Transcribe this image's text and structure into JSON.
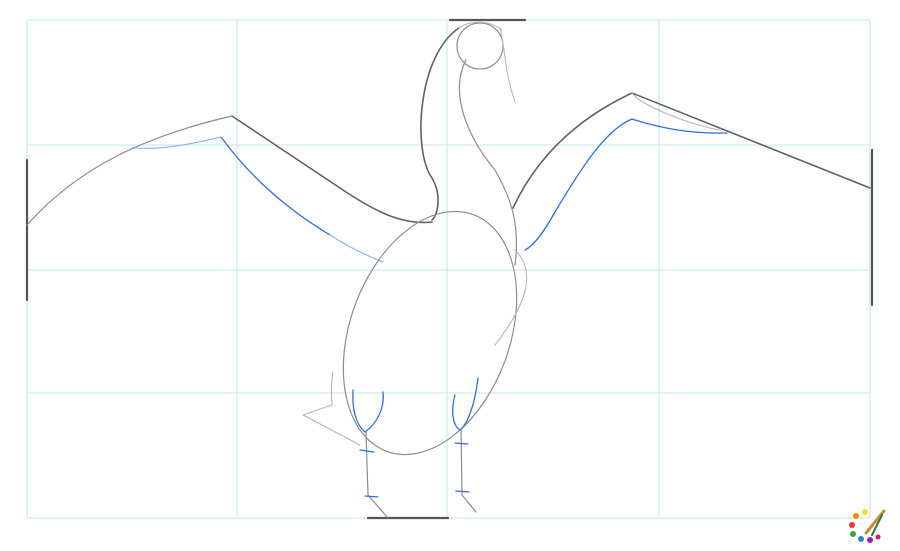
{
  "drawing": {
    "subject": "",
    "step_colors": {
      "grid": "#bfe6ee",
      "previous_lines": "#8a8d90",
      "current_step": "#2f6fe0"
    }
  },
  "logo": {
    "icon": "palette-brush-icon",
    "dot_colors": [
      "#e53935",
      "#fb8c00",
      "#fdd835",
      "#43a047",
      "#1e88e5",
      "#8e24aa",
      "#d81b60"
    ]
  }
}
